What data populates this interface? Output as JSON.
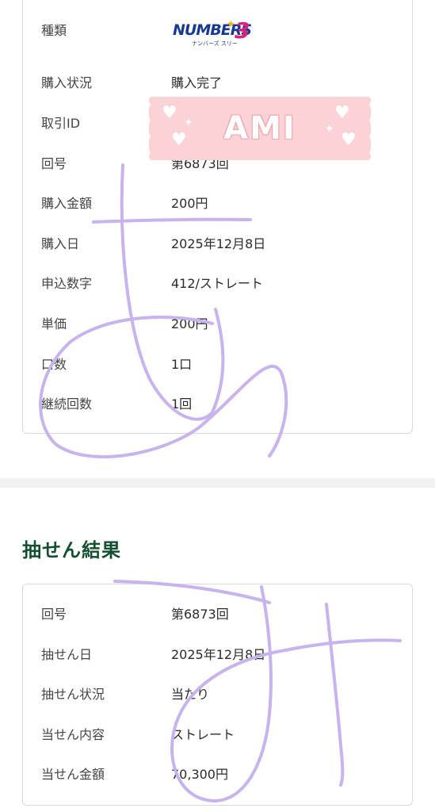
{
  "purchase": {
    "rows": [
      {
        "label": "種類",
        "value": ""
      },
      {
        "label": "購入状況",
        "value": "購入完了"
      },
      {
        "label": "取引ID",
        "value": ""
      },
      {
        "label": "回号",
        "value": "第6873回"
      },
      {
        "label": "購入金額",
        "value": "200円"
      },
      {
        "label": "購入日",
        "value": "2025年12月8日"
      },
      {
        "label": "申込数字",
        "value": "412/ストレート"
      },
      {
        "label": "単価",
        "value": "200円"
      },
      {
        "label": "口数",
        "value": "1口"
      },
      {
        "label": "継続回数",
        "value": "1回"
      }
    ],
    "logo": {
      "main": "NUMBERS",
      "number": "3",
      "sub": "ナンバーズ スリー"
    }
  },
  "sticker": {
    "text": "AMI"
  },
  "results": {
    "title": "抽せん結果",
    "rows": [
      {
        "label": "回号",
        "value": "第6873回"
      },
      {
        "label": "抽せん日",
        "value": "2025年12月8日"
      },
      {
        "label": "抽せん状況",
        "value": "当たり"
      },
      {
        "label": "当せん内容",
        "value": "ストレート"
      },
      {
        "label": "当せん金額",
        "value": "70,300円"
      }
    ]
  },
  "colors": {
    "accent": "#14502e",
    "logo_blue": "#163a94",
    "logo_pink": "#d8247a",
    "scribble": "#c7b3ee",
    "sticker_bg": "#fbd2d6"
  }
}
